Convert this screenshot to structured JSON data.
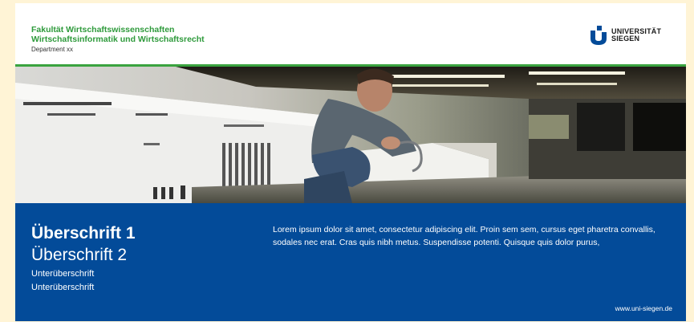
{
  "header": {
    "faculty": "Fakultät Wirtschaftswissenschaften",
    "program": "Wirtschaftsinformatik und Wirtschaftsrecht",
    "department": "Department xx"
  },
  "logo": {
    "line1": "UNIVERSITÄT",
    "line2": "SIEGEN",
    "icon": "university-siegen-logo",
    "color": "#034b99"
  },
  "photo": {
    "icon": "architecture-model-photo"
  },
  "panel": {
    "heading1": "Überschrift 1",
    "heading2": "Überschrift 2",
    "subheading1": "Unterüberschrift",
    "subheading2": "Unterüberschrift",
    "body": "Lorem ipsum dolor sit amet, consectetur adipiscing elit. Proin sem sem, cursus eget pharetra convallis, sodales nec erat. Cras quis nibh metus. Suspendisse potenti. Quisque quis dolor purus,",
    "url": "www.uni-siegen.de"
  },
  "colors": {
    "accent_green": "#3aa33f",
    "panel_blue": "#034b99",
    "background": "#fff4d6"
  }
}
